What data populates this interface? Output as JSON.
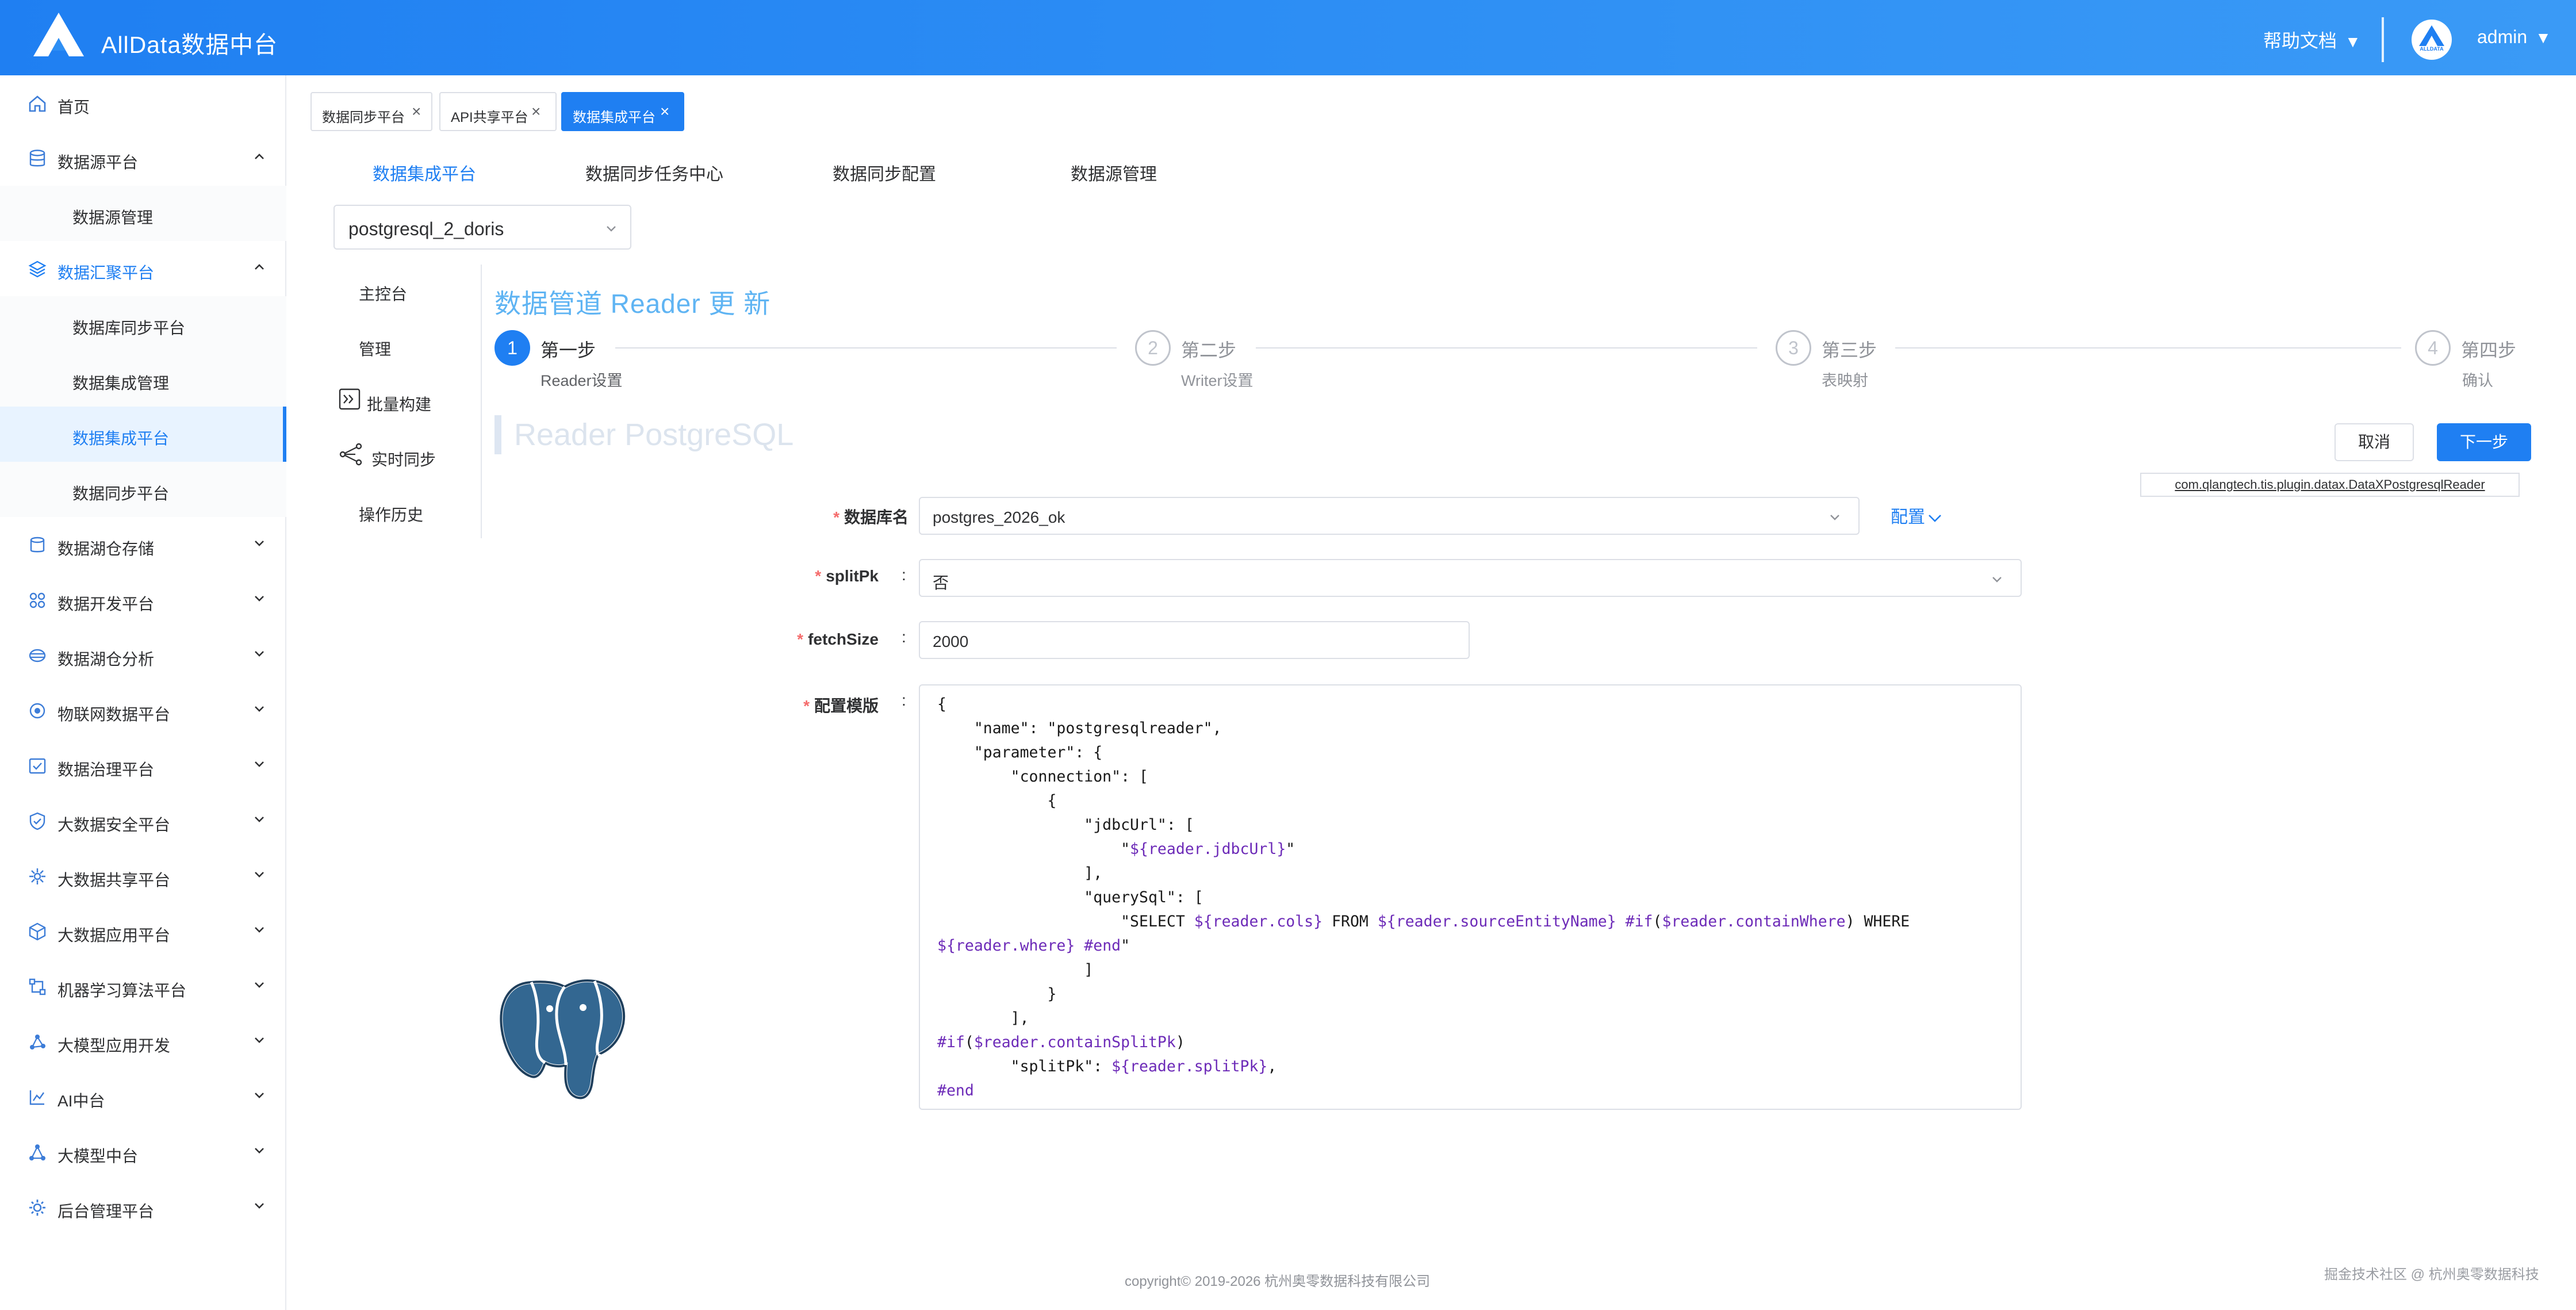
{
  "header": {
    "app_title": "AllData数据中台",
    "help_label": "帮助文档",
    "user_name": "admin",
    "avatar_text": "ALLDATA"
  },
  "sidebar": {
    "items": [
      {
        "label": "首页",
        "icon": "home-icon"
      },
      {
        "label": "数据源平台",
        "icon": "database-icon",
        "expanded": true
      },
      {
        "label": "数据源管理",
        "sub": true
      },
      {
        "label": "数据汇聚平台",
        "icon": "layers-icon",
        "expanded": true
      },
      {
        "label": "数据库同步平台",
        "sub": true
      },
      {
        "label": "数据集成管理",
        "sub": true
      },
      {
        "label": "数据集成平台",
        "sub": true,
        "active": true
      },
      {
        "label": "数据同步平台",
        "sub": true
      },
      {
        "label": "数据湖仓存储",
        "icon": "storage-icon"
      },
      {
        "label": "数据开发平台",
        "icon": "grid-icon"
      },
      {
        "label": "数据湖仓分析",
        "icon": "analysis-icon"
      },
      {
        "label": "物联网数据平台",
        "icon": "iot-icon"
      },
      {
        "label": "数据治理平台",
        "icon": "governance-icon"
      },
      {
        "label": "大数据安全平台",
        "icon": "shield-icon"
      },
      {
        "label": "大数据共享平台",
        "icon": "share-icon"
      },
      {
        "label": "大数据应用平台",
        "icon": "cube-icon"
      },
      {
        "label": "机器学习算法平台",
        "icon": "ml-icon"
      },
      {
        "label": "大模型应用开发",
        "icon": "nodes-icon"
      },
      {
        "label": "AI中台",
        "icon": "ai-icon"
      },
      {
        "label": "大模型中台",
        "icon": "model-icon"
      },
      {
        "label": "后台管理平台",
        "icon": "gear-icon"
      }
    ]
  },
  "tags": [
    {
      "label": "数据同步平台",
      "active": false
    },
    {
      "label": "API共享平台",
      "active": false
    },
    {
      "label": "数据集成平台",
      "active": true
    }
  ],
  "subtabs": [
    "数据集成平台",
    "数据同步任务中心",
    "数据同步配置",
    "数据源管理"
  ],
  "pipeline_select": {
    "value": "postgresql_2_doris"
  },
  "inner_menu": [
    "主控台",
    "管理",
    "批量构建",
    "实时同步",
    "操作历史"
  ],
  "page_title": "数据管道 Reader 更 新",
  "steps": [
    {
      "num": "1",
      "title": "第一步",
      "desc": "Reader设置",
      "active": true
    },
    {
      "num": "2",
      "title": "第二步",
      "desc": "Writer设置",
      "active": false
    },
    {
      "num": "3",
      "title": "第三步",
      "desc": "表映射",
      "active": false
    },
    {
      "num": "4",
      "title": "第四步",
      "desc": "确认",
      "active": false
    }
  ],
  "reader_heading": "Reader PostgreSQL",
  "actions": {
    "cancel": "取消",
    "next": "下一步"
  },
  "plugin_class": "com.qlangtech.tis.plugin.datax.DataXPostgresqlReader",
  "form": {
    "db_name": {
      "label": "数据库名",
      "value": "postgres_2026_ok"
    },
    "config_link": "配置",
    "split_pk": {
      "label": "splitPk",
      "value": "否"
    },
    "fetch_size": {
      "label": "fetchSize",
      "value": "2000"
    },
    "template": {
      "label": "配置模版"
    }
  },
  "code_lines": [
    "{",
    "    \"name\": \"postgresqlreader\",",
    "    \"parameter\": {",
    "        \"connection\": [",
    "            {",
    "                \"jdbcUrl\": [",
    "                    \"${reader.jdbcUrl}\"",
    "                ],",
    "                \"querySql\": [",
    "                    \"SELECT ${reader.cols} FROM ${reader.sourceEntityName} #if($reader.containWhere) WHERE",
    "${reader.where} #end\"",
    "                ]",
    "            }",
    "        ],",
    "#if($reader.containSplitPk)",
    "        \"splitPk\": ${reader.splitPk},",
    "#end"
  ],
  "footer": {
    "copyright": "copyright© 2019-2026 杭州奥零数据科技有限公司",
    "watermark": "掘金技术社区 @ 杭州奥零数据科技"
  },
  "colors": {
    "primary": "#1f7ff2",
    "required": "#f56c6c",
    "heading": "#5fb4f3"
  }
}
